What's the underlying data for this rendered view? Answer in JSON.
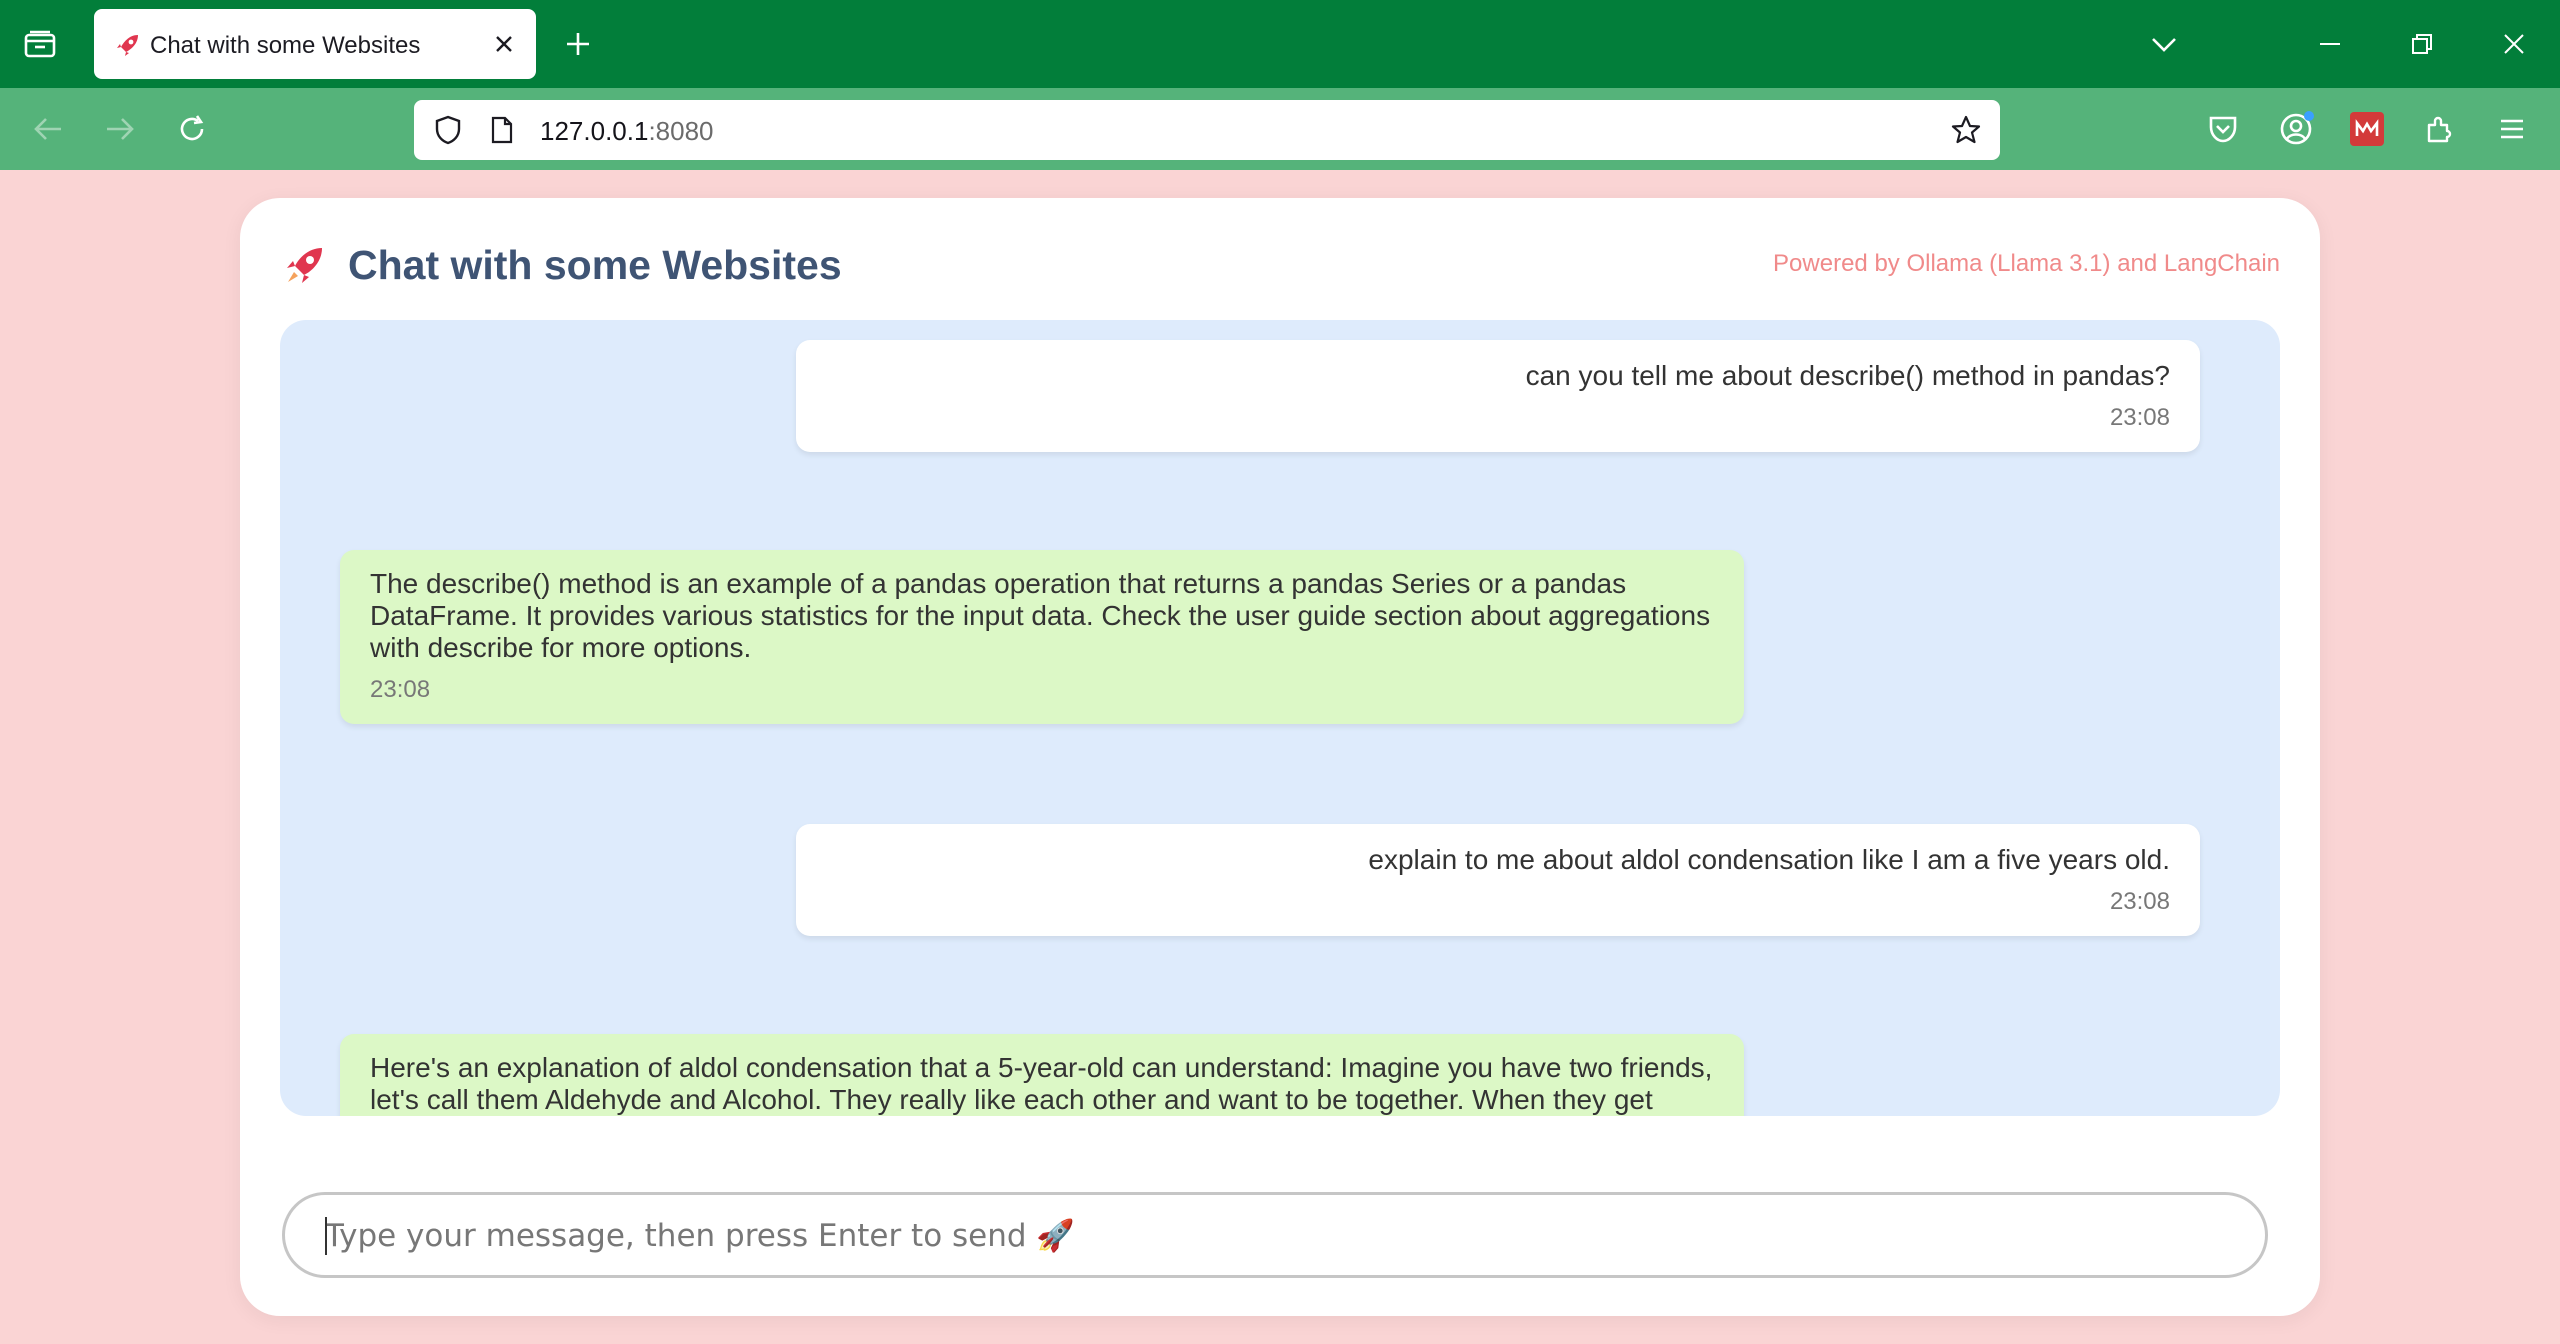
{
  "browser": {
    "tab_title": "Chat with some Websites",
    "url_host": "127.0.0.1",
    "url_port": ":8080"
  },
  "app": {
    "title": "Chat with some Websites",
    "powered_by": "Powered by Ollama (Llama 3.1) and LangChain",
    "accent_color": "#e0364f"
  },
  "messages": [
    {
      "role": "user",
      "text": "can you tell me about describe() method in pandas?",
      "time": "23:08"
    },
    {
      "role": "bot",
      "text": "The describe() method is an example of a pandas operation that returns a pandas Series or a pandas DataFrame. It provides various statistics for the input data. Check the user guide section about aggregations with describe for more options.",
      "time": "23:08"
    },
    {
      "role": "user",
      "text": "explain to me about aldol condensation like I am a five years old.",
      "time": "23:08"
    },
    {
      "role": "bot",
      "text": "Here's an explanation of aldol condensation that a 5-year-old can understand: Imagine you have two friends, let's call them Aldehyde and Alcohol. They really like each other and want to be together. When they get",
      "time": ""
    }
  ],
  "composer": {
    "placeholder": "Type your message, then press Enter to send 🚀"
  },
  "colors": {
    "tabbar": "#027e3a",
    "navbar": "#55b37a",
    "page_bg": "#fad4d4",
    "chat_bg": "#deebfc",
    "bot_bubble": "#dcf8c6"
  }
}
